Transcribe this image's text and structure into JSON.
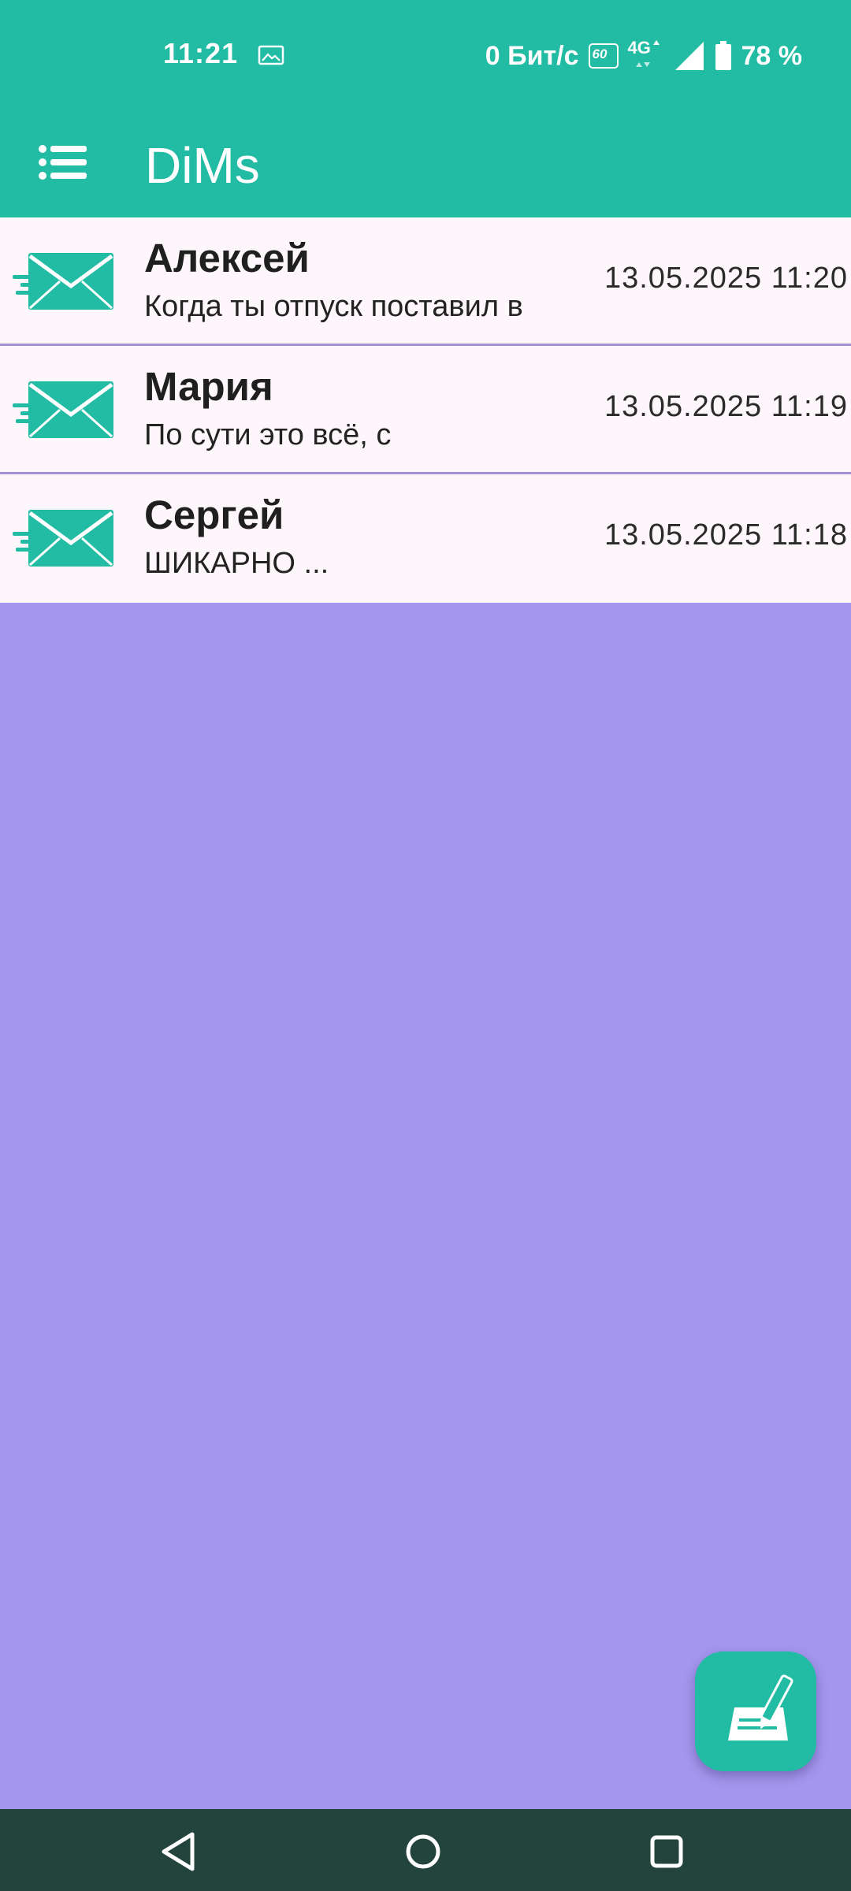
{
  "status_bar": {
    "time": "11:21",
    "network_speed": "0 Бит/с",
    "refresh_rate_badge": "60",
    "network_type": "4G",
    "battery": "78 %",
    "icons": [
      "gallery-icon",
      "refresh-rate-icon",
      "network-4g-icon",
      "signal-icon",
      "battery-icon"
    ]
  },
  "app_bar": {
    "title": "DiMs",
    "menu_icon": "list-menu-icon"
  },
  "messages": [
    {
      "name": "Алексей",
      "preview": "Когда ты отпуск поставил в",
      "date": "13.05.2025 11:20",
      "icon": "envelope-send-icon"
    },
    {
      "name": "Мария",
      "preview": "По сути это всё, с",
      "date": "13.05.2025 11:19",
      "icon": "envelope-send-icon"
    },
    {
      "name": "Сергей",
      "preview": "ШИКАРНО ...",
      "date": "13.05.2025 11:18",
      "icon": "envelope-send-icon"
    }
  ],
  "fab": {
    "icon": "compose-icon"
  },
  "nav_bar": {
    "icons": [
      "back-icon",
      "home-icon",
      "recents-icon"
    ]
  },
  "colors": {
    "accent": "#22bba3",
    "background": "#a496ee",
    "row_background": "#fdf7fc",
    "divider": "#a192d8",
    "nav_bar": "#23433d"
  }
}
